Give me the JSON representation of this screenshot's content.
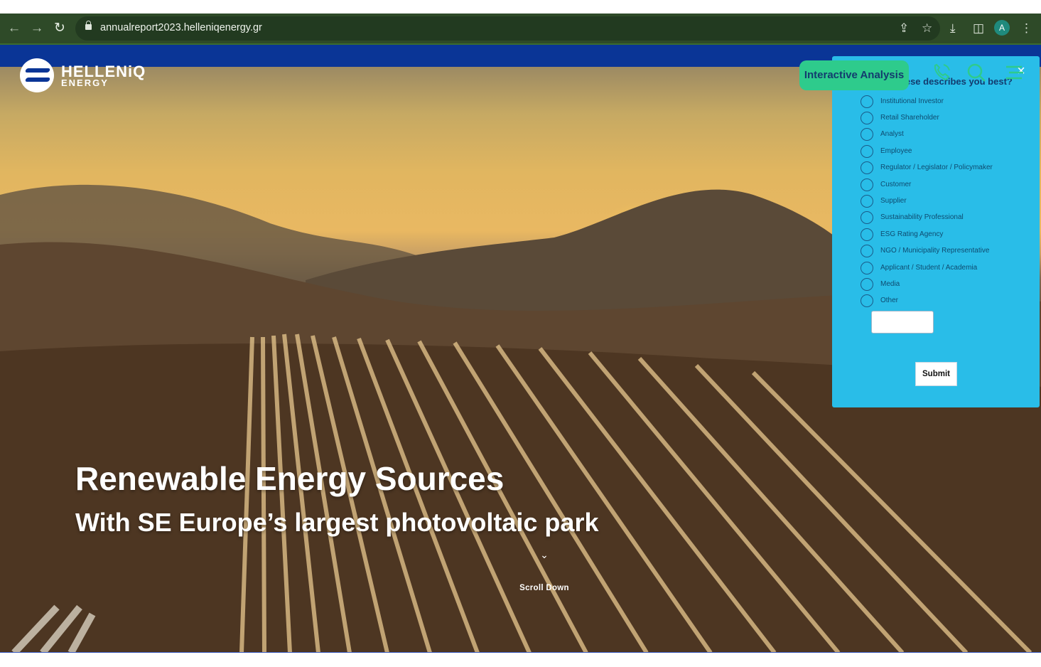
{
  "browser": {
    "url": "annualreport2023.helleniqenergy.gr",
    "avatar_letter": "A",
    "icons": [
      "back-icon",
      "forward-icon",
      "reload-icon",
      "lock-icon",
      "share-icon",
      "star-icon",
      "download-icon",
      "sidepanel-icon",
      "menu-dots-icon"
    ]
  },
  "site": {
    "logo_name": "HELLENiQ",
    "logo_sub": "ENERGY",
    "brand_color": "#0a3596",
    "accent_color": "#2ecb8c"
  },
  "hero": {
    "headline": "Renewable Energy Sources",
    "subline": "With SE Europe’s largest  photovoltaic park",
    "scroll_label": "Scroll Down"
  },
  "badge": {
    "label": "Interactive Analysis"
  },
  "survey": {
    "title": "...ese describes you best?",
    "options": [
      "Institutional Investor",
      "Retail Shareholder",
      "Analyst",
      "Employee",
      "Regulator / Legislator / Policymaker",
      "Customer",
      "Supplier",
      "Sustainability Professional",
      "ESG Rating Agency",
      "NGO / Municipality Representative",
      "Applicant / Student / Academia",
      "Media",
      "Other"
    ],
    "other_value": "",
    "submit_label": "Submit",
    "close_label": "×"
  }
}
